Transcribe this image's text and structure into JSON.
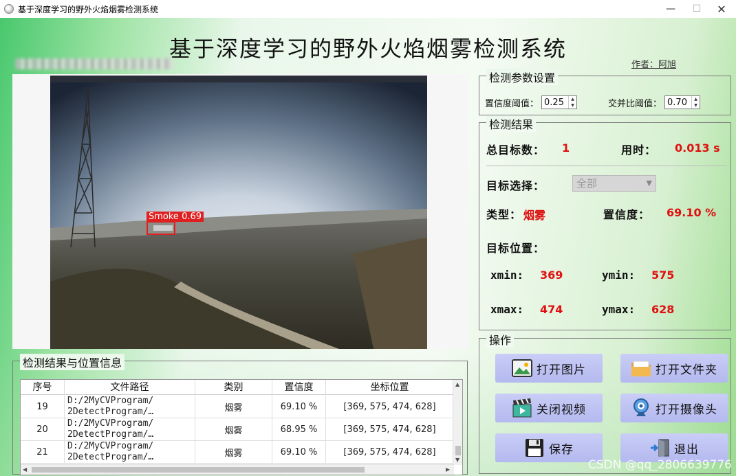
{
  "window": {
    "title": "基于深度学习的野外火焰烟雾检测系统",
    "min": "—",
    "max": "☐",
    "close": "✕"
  },
  "header": {
    "title": "基于深度学习的野外火焰烟雾检测系统",
    "author": "作者：阿旭"
  },
  "image": {
    "detection_label": "Smoke  0.69",
    "icon": "fire-scene-image"
  },
  "params": {
    "title": "检测参数设置",
    "conf_label": "置信度阈值：",
    "conf_value": "0.25",
    "iou_label": "交并比阈值：",
    "iou_value": "0.70"
  },
  "results": {
    "title": "检测结果",
    "total_label": "总目标数：",
    "total_value": "1",
    "time_label": "用时：",
    "time_value": "0.013 s",
    "select_label": "目标选择：",
    "select_value": "全部",
    "type_label": "类型：",
    "type_value": "烟雾",
    "conf_label": "置信度：",
    "conf_value": "69.10 %",
    "position_label": "目标位置：",
    "xmin_label": "xmin:",
    "xmin_value": "369",
    "ymin_label": "ymin:",
    "ymin_value": "575",
    "xmax_label": "xmax:",
    "xmax_value": "474",
    "ymax_label": "ymax:",
    "ymax_value": "628"
  },
  "operations": {
    "title": "操作",
    "open_image": "打开图片",
    "open_folder": "打开文件夹",
    "close_video": "关闭视频",
    "open_camera": "打开摄像头",
    "save": "保存",
    "exit": "退出"
  },
  "table": {
    "title": "检测结果与位置信息",
    "headers": [
      "序号",
      "文件路径",
      "类别",
      "置信度",
      "坐标位置"
    ],
    "rows": [
      {
        "index": "19",
        "path": "D:/2MyCVProgram/\n2DetectProgram/…",
        "category": "烟雾",
        "confidence": "69.10 %",
        "coords": "[369, 575, 474, 628]"
      },
      {
        "index": "20",
        "path": "D:/2MyCVProgram/\n2DetectProgram/…",
        "category": "烟雾",
        "confidence": "68.95 %",
        "coords": "[369, 575, 474, 628]"
      },
      {
        "index": "21",
        "path": "D:/2MyCVProgram/\n2DetectProgram/…",
        "category": "烟雾",
        "confidence": "69.10 %",
        "coords": "[369, 575, 474, 628]"
      }
    ]
  },
  "watermark": "CSDN @qq_2806639776",
  "colors": {
    "accent_red": "#e01010",
    "button_bg": "#c0c4f4",
    "detect_box": "#e02020"
  }
}
